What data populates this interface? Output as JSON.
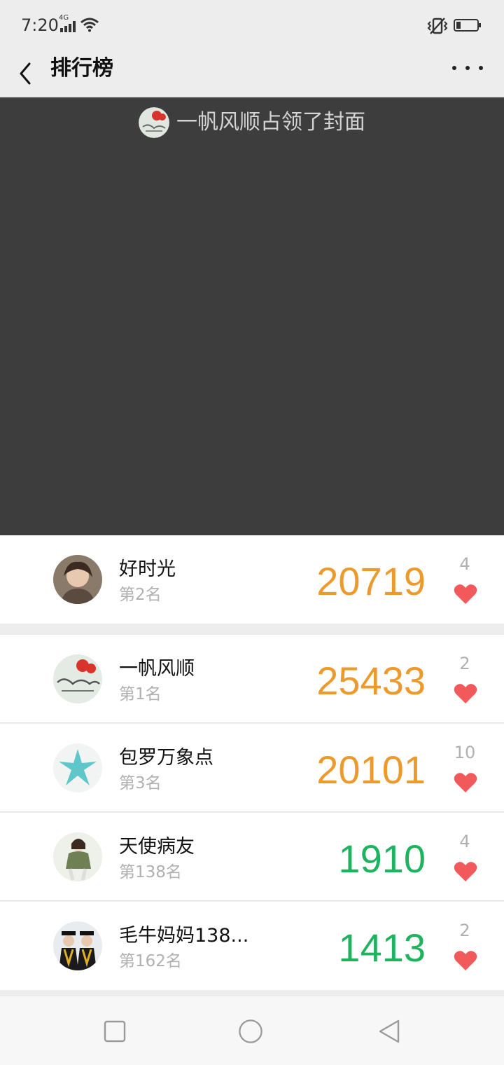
{
  "status_bar": {
    "time": "7:20",
    "network": "4G",
    "icons": [
      "signal-icon",
      "wifi-icon",
      "vibrate-icon",
      "battery-icon"
    ]
  },
  "nav": {
    "title": "排行榜",
    "back_icon": "chevron-left-icon",
    "more_icon": "more-dots-icon"
  },
  "cover": {
    "text": "一帆风顺占领了封面"
  },
  "my_entry": {
    "name": "好时光",
    "rank": "第2名",
    "steps": "20719",
    "likes": "4"
  },
  "ranking": [
    {
      "name": "一帆风顺",
      "rank": "第1名",
      "steps": "25433",
      "likes": "2",
      "steps_color": "#ec9a2c"
    },
    {
      "name": "包罗万象点",
      "rank": "第3名",
      "steps": "20101",
      "likes": "10",
      "steps_color": "#ec9a2c"
    },
    {
      "name": "天使病友",
      "rank": "第138名",
      "steps": "1910",
      "likes": "4",
      "steps_color": "#1fb35f"
    },
    {
      "name": "毛牛妈妈138...",
      "rank": "第162名",
      "steps": "1413",
      "likes": "2",
      "steps_color": "#1fb35f"
    }
  ],
  "colors": {
    "high_steps": "#ec9a2c",
    "low_steps": "#1fb35f",
    "heart": "#f2595b"
  },
  "bottom_nav": [
    "recents-square-icon",
    "home-circle-icon",
    "back-triangle-icon"
  ]
}
